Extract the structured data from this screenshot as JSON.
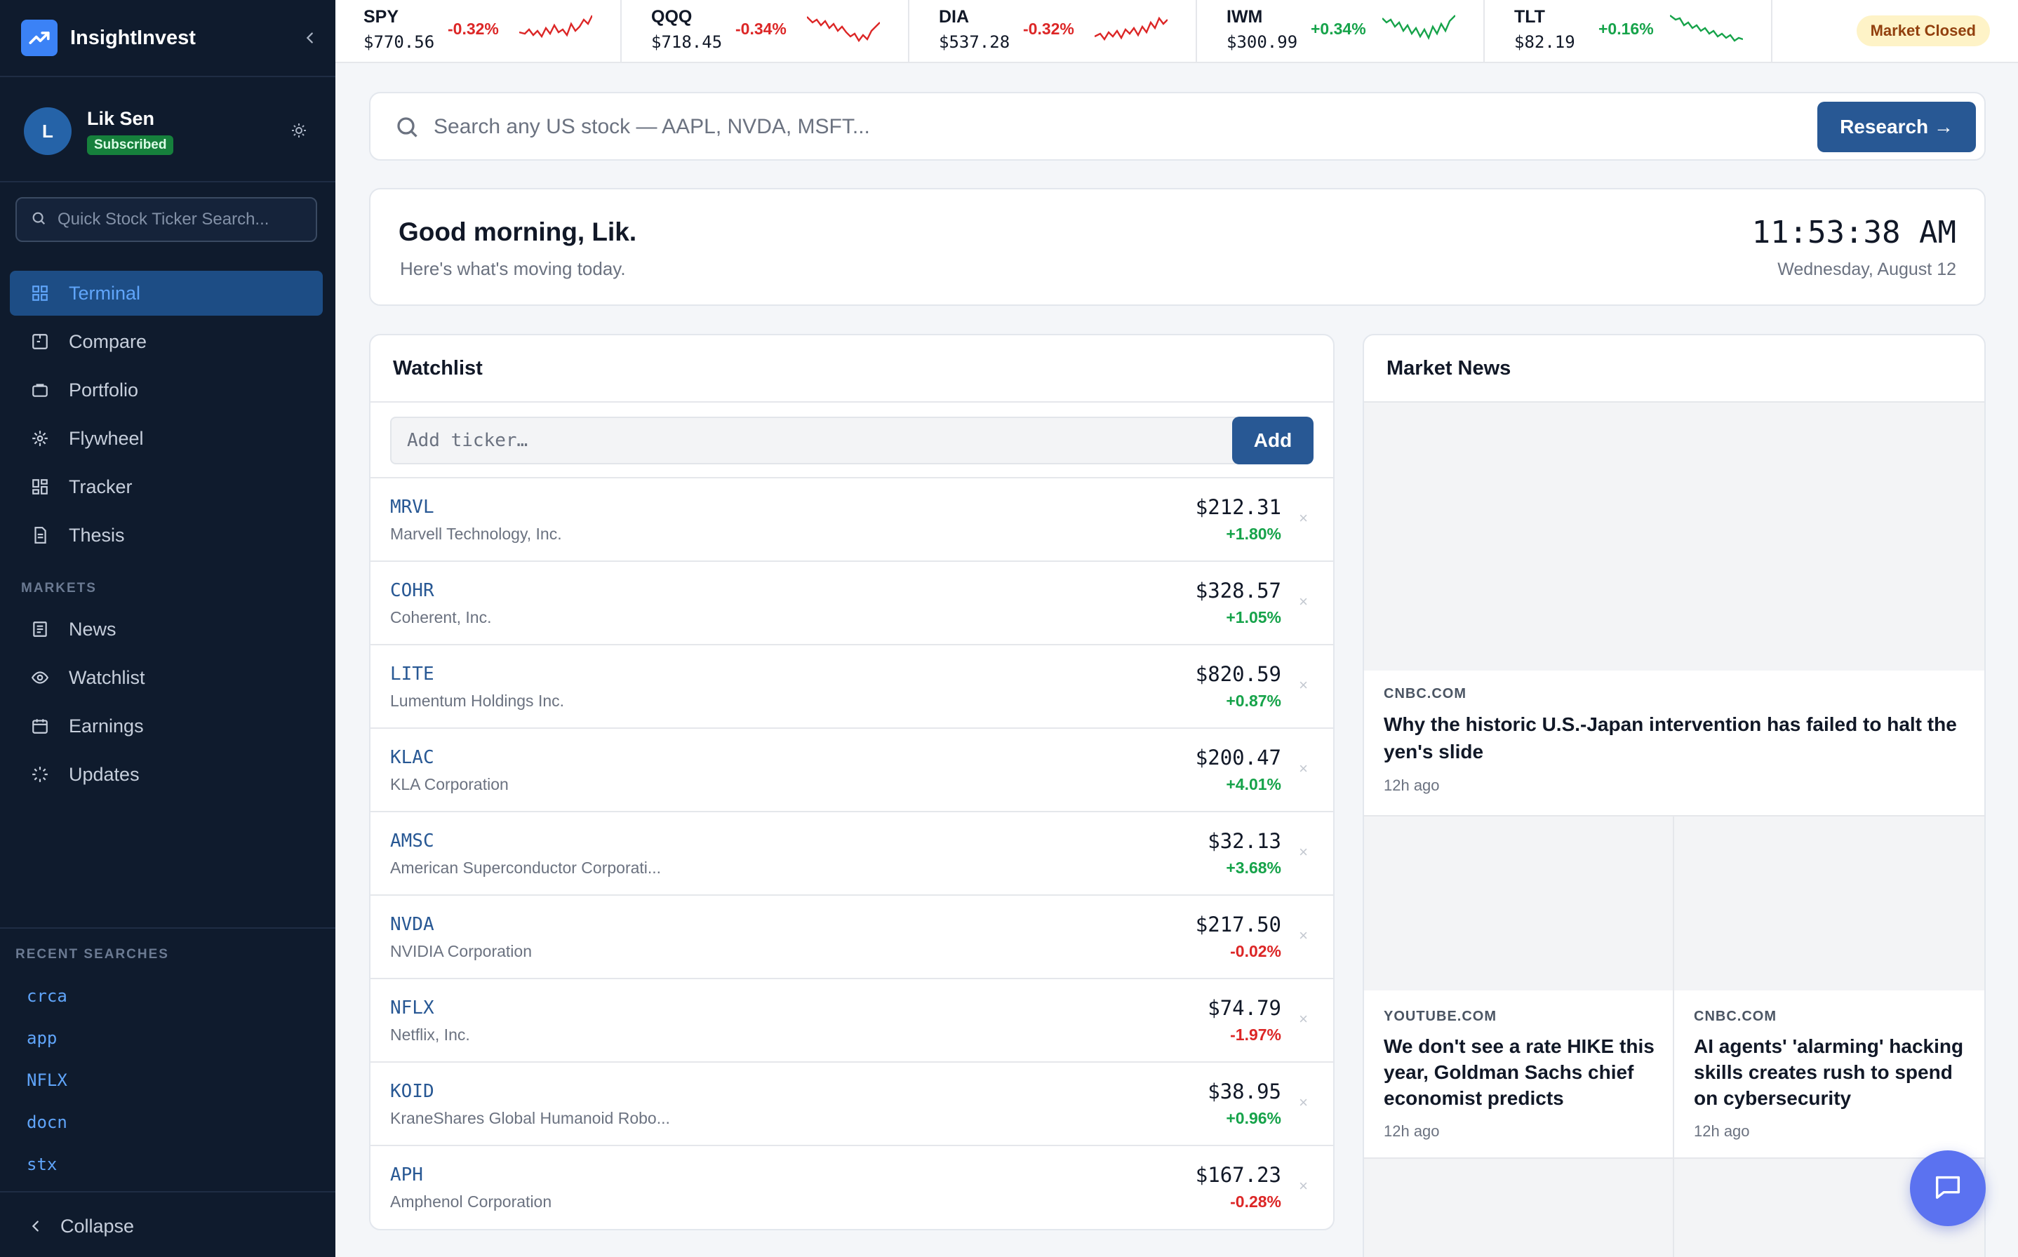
{
  "app": {
    "name": "InsightInvest"
  },
  "user": {
    "initial": "L",
    "name": "Lik Sen",
    "badge": "Subscribed"
  },
  "sidebar": {
    "search_placeholder": "Quick Stock Ticker Search...",
    "nav": [
      {
        "label": "Terminal",
        "icon": "grid-icon",
        "active": true
      },
      {
        "label": "Compare",
        "icon": "compare-icon"
      },
      {
        "label": "Portfolio",
        "icon": "briefcase-icon"
      },
      {
        "label": "Flywheel",
        "icon": "sun-icon"
      },
      {
        "label": "Tracker",
        "icon": "layout-icon"
      },
      {
        "label": "Thesis",
        "icon": "document-icon"
      }
    ],
    "markets_label": "MARKETS",
    "markets": [
      {
        "label": "News",
        "icon": "newspaper-icon"
      },
      {
        "label": "Watchlist",
        "icon": "eye-icon"
      },
      {
        "label": "Earnings",
        "icon": "calendar-icon"
      },
      {
        "label": "Updates",
        "icon": "loader-icon"
      }
    ],
    "recent_label": "RECENT SEARCHES",
    "recent": [
      "crca",
      "app",
      "NFLX",
      "docn",
      "stx"
    ],
    "collapse_label": "Collapse"
  },
  "tickers": [
    {
      "symbol": "SPY",
      "price": "$770.56",
      "change": "-0.32%",
      "dir": "down"
    },
    {
      "symbol": "QQQ",
      "price": "$718.45",
      "change": "-0.34%",
      "dir": "down"
    },
    {
      "symbol": "DIA",
      "price": "$537.28",
      "change": "-0.32%",
      "dir": "down"
    },
    {
      "symbol": "IWM",
      "price": "$300.99",
      "change": "+0.34%",
      "dir": "up"
    },
    {
      "symbol": "TLT",
      "price": "$82.19",
      "change": "+0.16%",
      "dir": "up"
    }
  ],
  "market_status": "Market Closed",
  "research": {
    "placeholder": "Search any US stock — AAPL, NVDA, MSFT...",
    "button": "Research →"
  },
  "greeting": {
    "title": "Good morning, Lik.",
    "subtitle": "Here's what's moving today.",
    "time": "11:53:38 AM",
    "date": "Wednesday, August 12"
  },
  "watchlist": {
    "title": "Watchlist",
    "add_placeholder": "Add ticker…",
    "add_button": "Add",
    "remove_glyph": "×",
    "rows": [
      {
        "symbol": "MRVL",
        "name": "Marvell Technology, Inc.",
        "price": "$212.31",
        "change": "+1.80%",
        "dir": "up"
      },
      {
        "symbol": "COHR",
        "name": "Coherent, Inc.",
        "price": "$328.57",
        "change": "+1.05%",
        "dir": "up"
      },
      {
        "symbol": "LITE",
        "name": "Lumentum Holdings Inc.",
        "price": "$820.59",
        "change": "+0.87%",
        "dir": "up"
      },
      {
        "symbol": "KLAC",
        "name": "KLA Corporation",
        "price": "$200.47",
        "change": "+4.01%",
        "dir": "up"
      },
      {
        "symbol": "AMSC",
        "name": "American Superconductor Corporati...",
        "price": "$32.13",
        "change": "+3.68%",
        "dir": "up"
      },
      {
        "symbol": "NVDA",
        "name": "NVIDIA Corporation",
        "price": "$217.50",
        "change": "-0.02%",
        "dir": "down"
      },
      {
        "symbol": "NFLX",
        "name": "Netflix, Inc.",
        "price": "$74.79",
        "change": "-1.97%",
        "dir": "down"
      },
      {
        "symbol": "KOID",
        "name": "KraneShares Global Humanoid Robo...",
        "price": "$38.95",
        "change": "+0.96%",
        "dir": "up"
      },
      {
        "symbol": "APH",
        "name": "Amphenol Corporation",
        "price": "$167.23",
        "change": "-0.28%",
        "dir": "down"
      }
    ]
  },
  "news": {
    "title": "Market News",
    "items": [
      {
        "source": "CNBC.COM",
        "title": "Why the historic U.S.-Japan intervention has failed to halt the yen's slide",
        "time": "12h ago"
      },
      {
        "source": "YOUTUBE.COM",
        "title": "We don't see a rate HIKE this year, Goldman Sachs chief economist predicts",
        "time": "12h ago"
      },
      {
        "source": "CNBC.COM",
        "title": "AI agents' 'alarming' hacking skills creates rush to spend on cybersecurity",
        "time": "12h ago"
      }
    ]
  },
  "colors": {
    "accent": "#285894",
    "up": "#16a34a",
    "down": "#dc2626",
    "sidebar_bg": "#0f1b2d"
  }
}
